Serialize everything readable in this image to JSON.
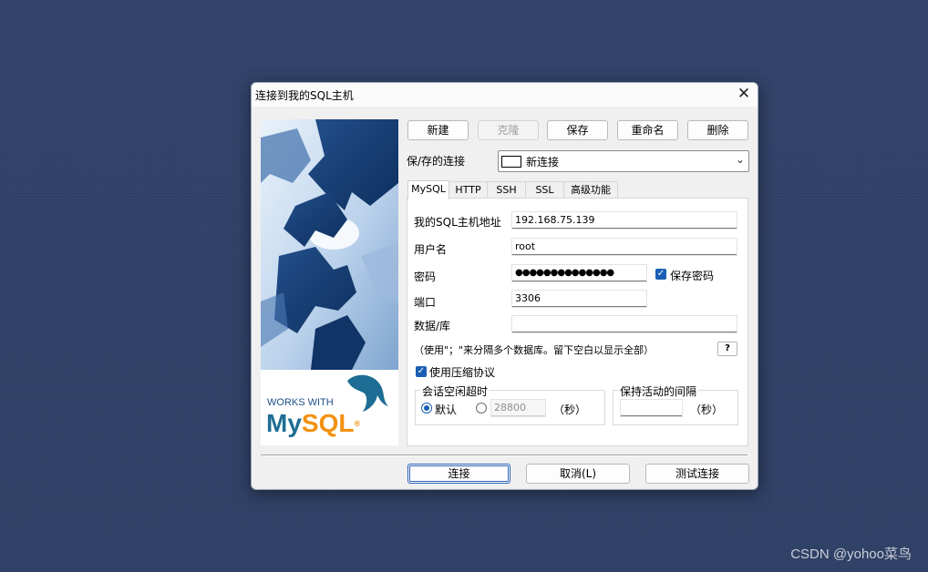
{
  "window": {
    "title": "连接到我的SQL主机",
    "close_glyph": "✕"
  },
  "artwork": {
    "works_with": "WORKS WITH",
    "brand_my": "My",
    "brand_sql": "SQL",
    "brand_reg": "®"
  },
  "toolbar": {
    "new_label": "新建",
    "clone_label": "克隆",
    "save_label": "保存",
    "rename_label": "重命名",
    "delete_label": "删除"
  },
  "saved_connection": {
    "label": "保/存的连接",
    "value": "新连接"
  },
  "tabs": [
    {
      "label": "MySQL",
      "active": true
    },
    {
      "label": "HTTP",
      "active": false
    },
    {
      "label": "SSH",
      "active": false
    },
    {
      "label": "SSL",
      "active": false
    },
    {
      "label": "高级功能",
      "active": false
    }
  ],
  "mysql": {
    "host_label": "我的SQL主机地址",
    "host_value": "192.168.75.139",
    "user_label": "用户名",
    "user_value": "root",
    "password_label": "密码",
    "password_value": "●●●●●●●●●●●●●●",
    "save_password_label": "保存密码",
    "port_label": "端口",
    "port_value": "3306",
    "database_label": "数据/库",
    "database_value": "",
    "database_hint": "（使用\"；\"来分隔多个数据库。留下空白以显示全部）",
    "help_label": "?",
    "compression_label": "使用压缩协议",
    "session_timeout": {
      "title": "会话空闲超时",
      "default_label": "默认",
      "value": "28800",
      "unit": "（秒）"
    },
    "keepalive": {
      "title": "保持活动的间隔",
      "value": "",
      "unit": "（秒）"
    }
  },
  "footer": {
    "connect_label": "连接",
    "cancel_label": "取消(L)",
    "test_label": "测试连接"
  },
  "watermark": "CSDN @yohoo菜鸟"
}
